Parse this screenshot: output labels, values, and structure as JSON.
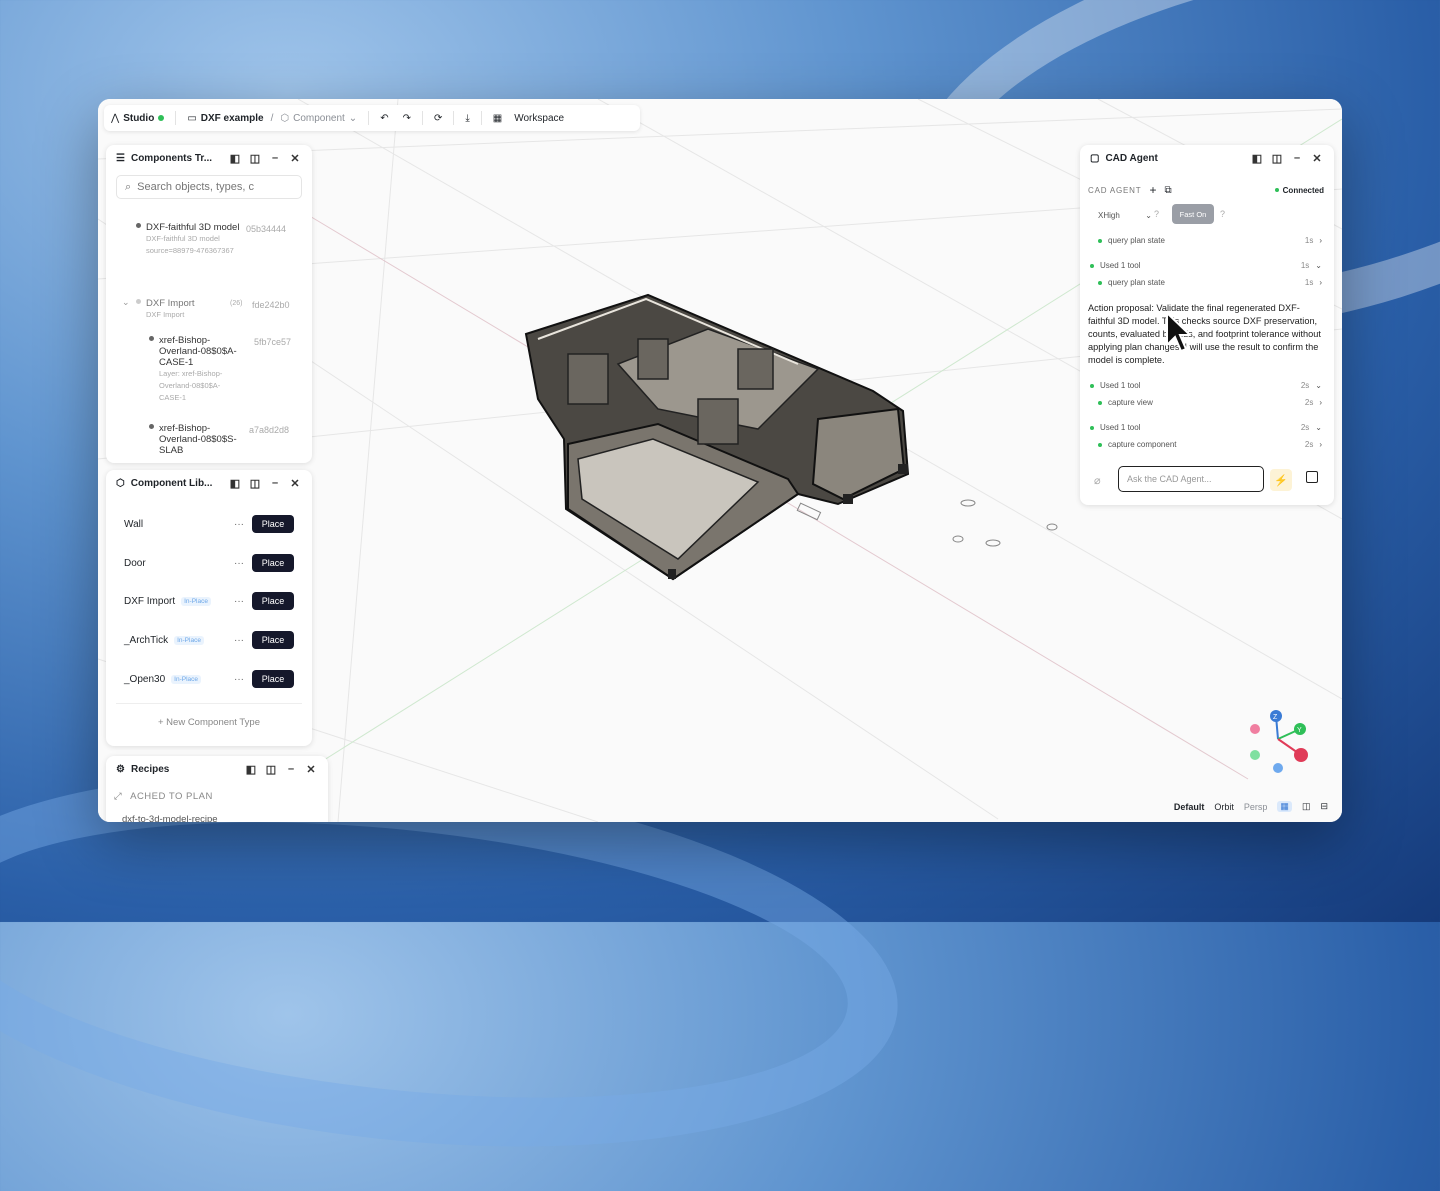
{
  "toolbar": {
    "app": "Studio",
    "project": "DXF example",
    "component": "Component",
    "workspace": "Workspace"
  },
  "components_tree": {
    "title": "Components Tr...",
    "search_placeholder": "Search objects, types, c",
    "items": [
      {
        "name": "DXF-faithful 3D model",
        "sub": "DXF-faithful 3D model source=88979-476367367",
        "hash": "05b34444"
      },
      {
        "name": "DXF Import",
        "sub": "DXF Import",
        "count": "(26)",
        "hash": "fde242b0"
      },
      {
        "name": "xref-Bishop-Overland-08$0$A-CASE-1",
        "sub": "Layer: xref-Bishop-Overland-08$0$A-CASE-1",
        "hash": "5fb7ce57"
      },
      {
        "name": "xref-Bishop-Overland-08$0$S-SLAB",
        "hash": "a7a8d2d8"
      }
    ]
  },
  "component_library": {
    "title": "Component Lib...",
    "place_label": "Place",
    "more_label": "···",
    "items": [
      {
        "name": "Wall",
        "tag": ""
      },
      {
        "name": "Door",
        "tag": ""
      },
      {
        "name": "DXF Import",
        "tag": "In-Place"
      },
      {
        "name": "_ArchTick",
        "tag": "In-Place"
      },
      {
        "name": "_Open30",
        "tag": "In-Place"
      }
    ],
    "new_type": "+ New Component Type"
  },
  "recipes": {
    "title": "Recipes",
    "attached": "ACHED TO PLAN",
    "recipe": "dxf-to-3d-model-recipe"
  },
  "cad_agent": {
    "title": "CAD Agent",
    "section": "CAD AGENT",
    "status": "Connected",
    "model": "XHigh",
    "fast": "Fast On",
    "rows": [
      {
        "label": "query plan state",
        "time": "1s",
        "arrow": "›"
      },
      {
        "label": "Used 1 tool",
        "time": "1s",
        "arrow": "⌄"
      },
      {
        "label": "query plan state",
        "time": "1s",
        "arrow": "›"
      }
    ],
    "message": "Action proposal: Validate the final regenerated DXF-faithful 3D model. This checks source DXF preservation, counts, evaluated bounds, and footprint tolerance without applying plan changes. I will use the result to confirm the model is complete.",
    "rows2": [
      {
        "label": "Used 1 tool",
        "time": "2s",
        "arrow": "⌄"
      },
      {
        "label": "capture view",
        "time": "2s",
        "arrow": "›"
      },
      {
        "label": "Used 1 tool",
        "time": "2s",
        "arrow": "⌄"
      },
      {
        "label": "capture component",
        "time": "2s",
        "arrow": "›"
      }
    ],
    "input_placeholder": "Ask the CAD Agent..."
  },
  "viewport": {
    "view_default": "Default",
    "view_orbit": "Orbit",
    "view_persp": "Persp",
    "axis_z": "Z",
    "axis_y": "Y"
  }
}
